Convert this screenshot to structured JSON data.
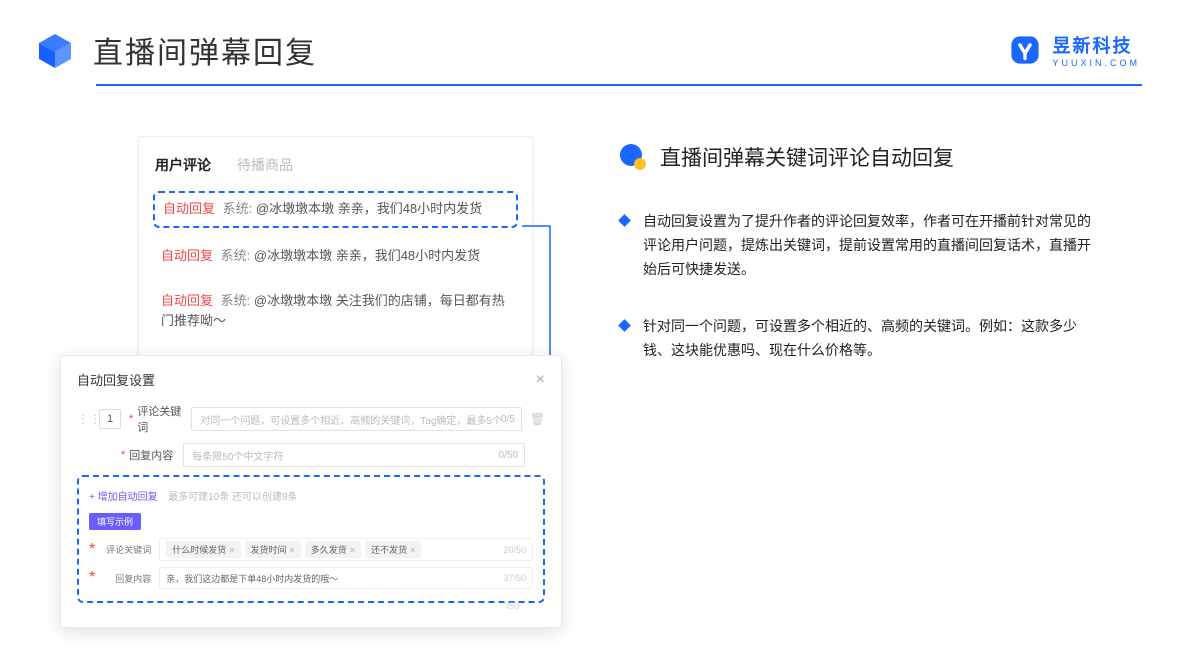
{
  "header": {
    "title": "直播间弹幕回复",
    "brand_name": "昱新科技",
    "brand_sub": "YUUXIN.COM"
  },
  "comments": {
    "tab_active": "用户评论",
    "tab_inactive": "待播商品",
    "badge": "自动回复",
    "sys_prefix": "系统:",
    "row1": "@冰墩墩本墩 亲亲，我们48小时内发货",
    "row2": "@冰墩墩本墩 亲亲，我们48小时内发货",
    "row3": "@冰墩墩本墩 关注我们的店铺，每日都有热门推荐呦～"
  },
  "settings": {
    "title": "自动回复设置",
    "num": "1",
    "label_keyword": "评论关键词",
    "label_content": "回复内容",
    "keyword_placeholder": "对同一个问题，可设置多个相近、高频的关键词，Tag确定，最多5个",
    "keyword_count": "0/5",
    "content_placeholder": "每条限50个中文字符",
    "content_count": "0/50",
    "add_link": "+ 增加自动回复",
    "add_hint": "最多可建10条 还可以创建9条",
    "example_label": "填写示例",
    "ex_label_keyword": "评论关键词",
    "ex_label_content": "回复内容",
    "tags": [
      "什么时候发货",
      "发货时间",
      "多久发货",
      "还不发货"
    ],
    "ex_keyword_count": "20/50",
    "ex_content_text": "亲，我们这边都是下单48小时内发货的哦～",
    "ex_content_count": "37/50",
    "trailing_count": "/50"
  },
  "right": {
    "section_title": "直播间弹幕关键词评论自动回复",
    "bullet1": "自动回复设置为了提升作者的评论回复效率，作者可在开播前针对常见的评论用户问题，提炼出关键词，提前设置常用的直播间回复话术，直播开始后可快捷发送。",
    "bullet2": "针对同一个问题，可设置多个相近的、高频的关键词。例如：这款多少钱、这块能优惠吗、现在什么价格等。"
  }
}
